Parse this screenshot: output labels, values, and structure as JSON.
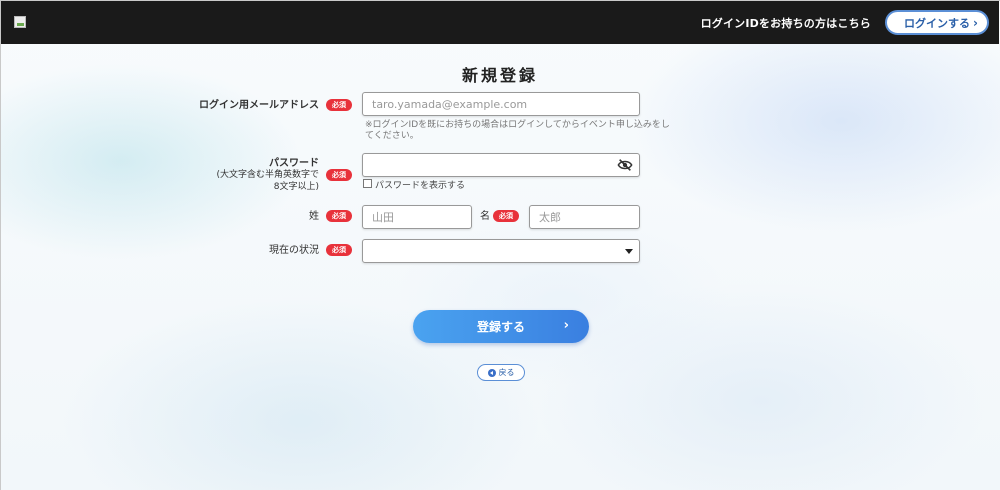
{
  "header": {
    "note": "ログインIDをお持ちの方はこちら",
    "login_button": "ログインする",
    "chevron": "›"
  },
  "form": {
    "title": "新規登録",
    "required_badge": "必須",
    "email": {
      "label": "ログイン用メールアドレス",
      "placeholder": "taro.yamada@example.com",
      "hint_line1": "※ログインIDを既にお持ちの場合はログインしてからイベント申し込みをし",
      "hint_line2": "てください。"
    },
    "password": {
      "label": "パスワード",
      "sub_line1": "(大文字含む半角英数字で",
      "sub_line2": "8文字以上)",
      "value": "",
      "show_password_label": "パスワードを表示する",
      "toggle_icon": "eye-slash-icon"
    },
    "last_name": {
      "label": "姓",
      "placeholder": "山田"
    },
    "first_name": {
      "label": "名",
      "placeholder": "太郎"
    },
    "status": {
      "label": "現在の状況",
      "selected": ""
    },
    "submit_label": "登録する",
    "back_label": "戻る"
  },
  "colors": {
    "header_bg": "#1a1a1a",
    "required": "#e8323b",
    "accent": "#3a7fe0"
  }
}
